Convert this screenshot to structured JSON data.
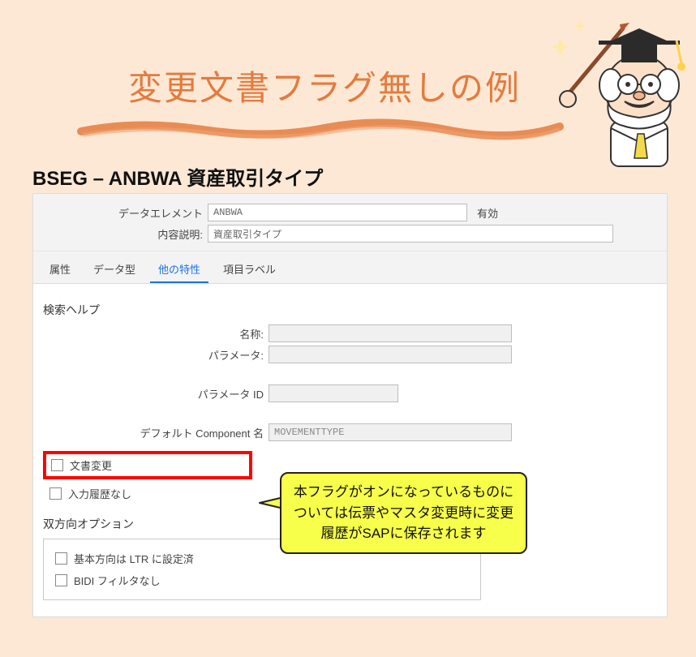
{
  "title": "変更文書フラグ無しの例",
  "heading": "BSEG – ANBWA 資産取引タイプ",
  "header": {
    "data_element_label": "データエレメント",
    "data_element_value": "ANBWA",
    "status_label": "有効",
    "description_label": "内容説明:",
    "description_value": "資産取引タイプ"
  },
  "tabs": {
    "t0": "属性",
    "t1": "データ型",
    "t2": "他の特性",
    "t3": "項目ラベル"
  },
  "search_help": {
    "group_label": "検索ヘルプ",
    "name_label": "名称:",
    "name_value": "",
    "param_label": "パラメータ:",
    "param_value": ""
  },
  "param_id": {
    "label": "パラメータ ID",
    "value": ""
  },
  "default_comp": {
    "label": "デフォルト Component 名",
    "value": "MOVEMENTTYPE"
  },
  "checks": {
    "doc_change": "文書変更",
    "no_input_history": "入力履歴なし"
  },
  "bidi": {
    "group_label": "双方向オプション",
    "ltr": "基本方向は LTR に設定済",
    "no_filter": "BIDI フィルタなし"
  },
  "callout": "本フラグがオンになっているものについては伝票やマスタ変更時に変更履歴がSAPに保存されます"
}
